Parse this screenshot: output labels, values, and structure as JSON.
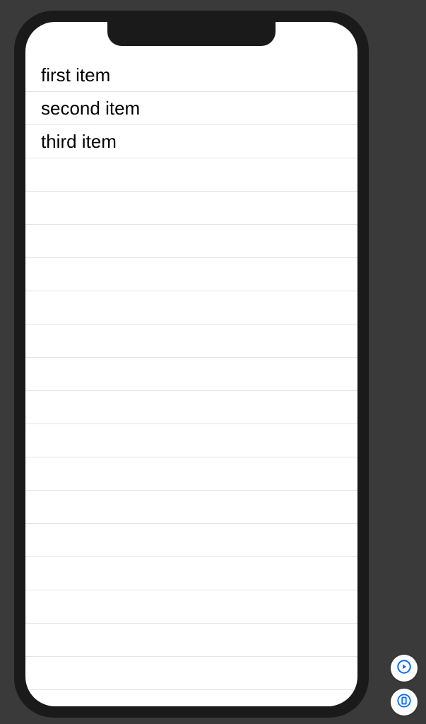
{
  "list": {
    "items": [
      {
        "label": "first item"
      },
      {
        "label": "second item"
      },
      {
        "label": "third item"
      }
    ]
  },
  "emptyRowCount": 17,
  "controls": {
    "play": "play-preview",
    "device": "device-preview"
  },
  "colors": {
    "accent": "#0a6cff",
    "divider": "#e5e5e7",
    "frame": "#1a1a1a",
    "background": "#3a3a3a"
  }
}
